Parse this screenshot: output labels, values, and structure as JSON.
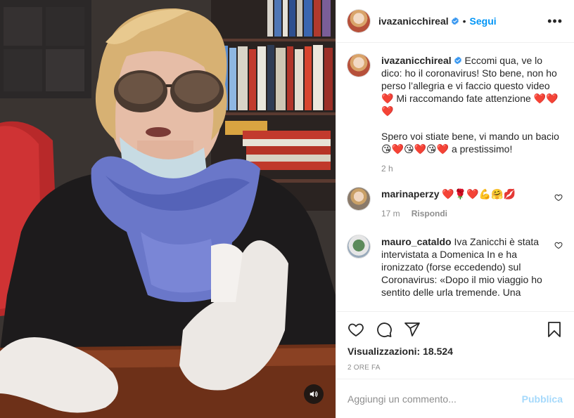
{
  "post": {
    "author": "ivazanicchireal",
    "header_separator": "•",
    "follow_label": "Segui",
    "more_label": "•••",
    "caption": {
      "username": "ivazanicchireal",
      "text": "Eccomi qua, ve lo dico: ho il coronavirus! Sto bene, non ho perso l’allegria e vi faccio questo video ❤️ Mi raccomando fate attenzione ❤️❤️❤️\n\nSpero voi stiate bene, vi mando un bacio 😘❤️😘❤️😘❤️ a prestissimo!",
      "time": "2 h"
    },
    "comments": [
      {
        "username": "marinaperzy",
        "text": "❤️🌹❤️💪🤗💋",
        "time": "17 m",
        "reply_label": "Rispondi"
      },
      {
        "username": "mauro_cataldo",
        "text": "Iva Zanicchi è stata intervistata a Domenica In e ha ironizzato (forse eccedendo) sul Coronavirus: «Dopo il mio viaggio ho sentito delle urla tremende. Una"
      }
    ],
    "views_label": "Visualizzazioni:",
    "views_count": "18.524",
    "timestamp": "2 ORE FA",
    "comment_placeholder": "Aggiungi un commento...",
    "publish_label": "Pubblica"
  },
  "icons": {
    "verified": "verified-badge-icon",
    "like": "heart-icon",
    "comment": "comment-icon",
    "share": "share-icon",
    "save": "bookmark-icon",
    "sound": "speaker-icon"
  },
  "colors": {
    "accent": "#0095f6",
    "text": "#262626",
    "muted": "#8e8e8e",
    "divider": "#efefef"
  }
}
